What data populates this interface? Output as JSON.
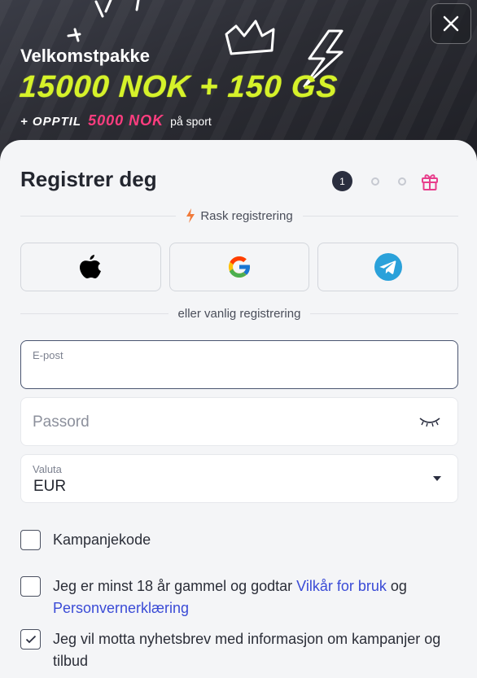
{
  "banner": {
    "title": "Velkomstpakke",
    "amount": "15000 NOK + 150 GS",
    "extra_prefix": "+ OPPTIL",
    "extra_amount": "5000 NOK",
    "extra_suffix": "på sport",
    "accent_color": "#d6f22a",
    "pink_color": "#ff3d7f"
  },
  "close_icon": "close-icon",
  "form": {
    "title": "Registrer deg",
    "step_current": "1",
    "quick_label": "Rask registrering",
    "social": [
      "apple-icon",
      "google-icon",
      "telegram-icon"
    ],
    "or_label": "eller vanlig registrering",
    "email_label": "E-post",
    "email_value": "",
    "password_placeholder": "Passord",
    "currency_label": "Valuta",
    "currency_value": "EUR",
    "promo_label": "Kampanjekode",
    "terms_prefix": "Jeg er minst 18 år gammel og godtar",
    "terms_link": "Vilkår for bruk",
    "terms_and": "og",
    "privacy_link": "Personvernerklæring",
    "newsletter_label": "Jeg vil motta nyhetsbrev med informasjon om kampanjer og tilbud",
    "newsletter_checked": true
  }
}
